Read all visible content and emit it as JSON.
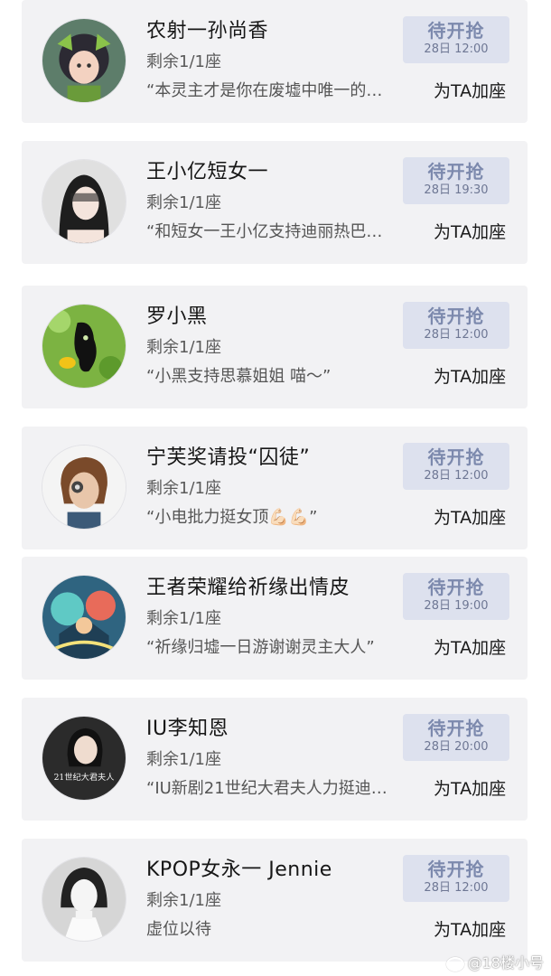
{
  "cards": [
    {
      "name": "农射一孙尚香",
      "seats": "剩余1/1座",
      "quote": "“本灵主才是你在废墟中唯一的…",
      "status": "待开抢",
      "time": "28日 12:00",
      "action": "为TA加座",
      "avatar_icon": "anime-girl-avatar",
      "avatar_color": "#4f6b5a"
    },
    {
      "name": "王小亿短女一",
      "seats": "剩余1/1座",
      "quote": "“和短女一王小亿支持迪丽热巴…",
      "status": "待开抢",
      "time": "28日 19:30",
      "action": "为TA加座",
      "avatar_icon": "woman-photo-avatar",
      "avatar_color": "#dcdcdc"
    },
    {
      "name": "罗小黑",
      "seats": "剩余1/1座",
      "quote": "“小黑支持思慕姐姐 喵～”",
      "status": "待开抢",
      "time": "28日 12:00",
      "action": "为TA加座",
      "avatar_icon": "black-cat-avatar",
      "avatar_color": "#7cb342"
    },
    {
      "name": "宁芙奖请投“囚徒”",
      "seats": "剩余1/1座",
      "quote": "“小电批力挺女顶💪🏻💪🏻”",
      "status": "待开抢",
      "time": "28日 12:00",
      "action": "为TA加座",
      "avatar_icon": "game-character-avatar",
      "avatar_color": "#f4f4f4"
    },
    {
      "name": "王者荣耀给祈缘出情皮",
      "seats": "剩余1/1座",
      "quote": "“祈缘归墟一日游谢谢灵主大人”",
      "status": "待开抢",
      "time": "28日 19:00",
      "action": "为TA加座",
      "avatar_icon": "game-art-avatar",
      "avatar_color": "#3a6e8a"
    },
    {
      "name": "IU李知恩",
      "seats": "剩余1/1座",
      "quote": "“IU新剧21世纪大君夫人力挺迪…",
      "status": "待开抢",
      "time": "28日 20:00",
      "action": "为TA加座",
      "avatar_icon": "poster-avatar",
      "avatar_color": "#2b2b2b",
      "avatar_text": "21世纪大君夫人"
    },
    {
      "name": "KPOP女永一 Jennie",
      "seats": "剩余1/1座",
      "quote": "虚位以待",
      "status": "待开抢",
      "time": "28日 12:00",
      "action": "为TA加座",
      "avatar_icon": "bw-portrait-avatar",
      "avatar_color": "#d0d0d0"
    }
  ],
  "watermark": "@18楼小号"
}
